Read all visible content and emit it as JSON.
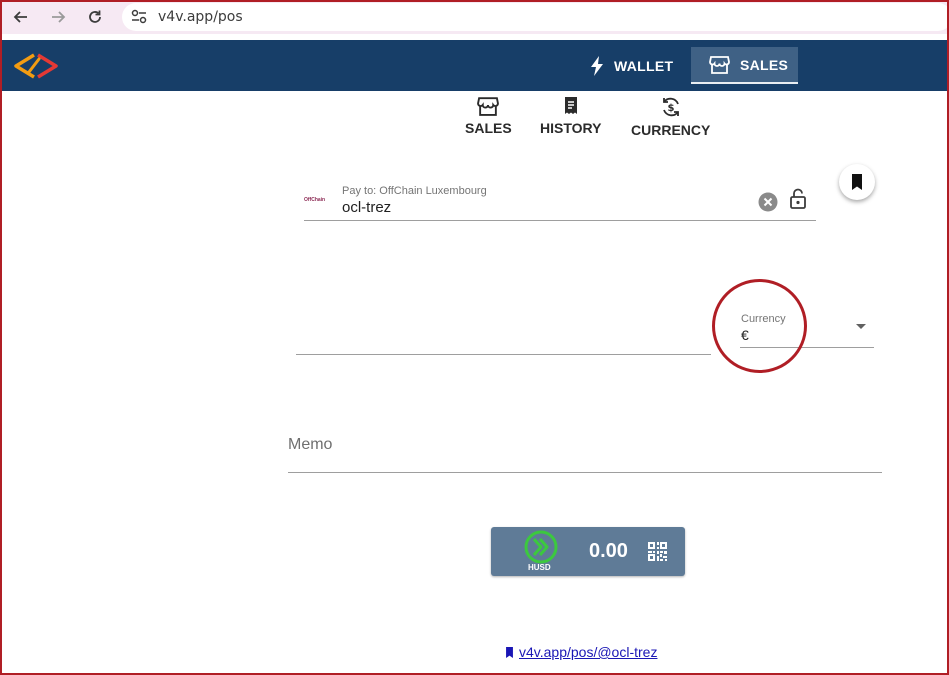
{
  "browser": {
    "url": "v4v.app/pos"
  },
  "app_bar": {
    "tabs": [
      {
        "label": "WALLET",
        "icon": "lightning-icon"
      },
      {
        "label": "SALES",
        "icon": "store-icon",
        "active": true
      }
    ]
  },
  "sub_nav": [
    {
      "label": "SALES",
      "icon": "store-icon"
    },
    {
      "label": "HISTORY",
      "icon": "receipt-icon"
    },
    {
      "label": "CURRENCY",
      "icon": "currency-exchange-icon"
    }
  ],
  "pay_to": {
    "logo_text": "OffChain",
    "label": "Pay to: OffChain Luxembourg",
    "value": "ocl-trez"
  },
  "currency": {
    "label": "Currency",
    "value": "€"
  },
  "memo": {
    "label": "Memo"
  },
  "pay_button": {
    "token": "HUSD",
    "amount": "0.00"
  },
  "link": {
    "text": " v4v.app/pos/@ocl-trez"
  },
  "colors": {
    "app_bar": "#173e68",
    "active_tab": "#3f6185",
    "pay_button": "#5f7b97",
    "annotation": "#b01e25",
    "hive_green": "#3cc83f"
  }
}
